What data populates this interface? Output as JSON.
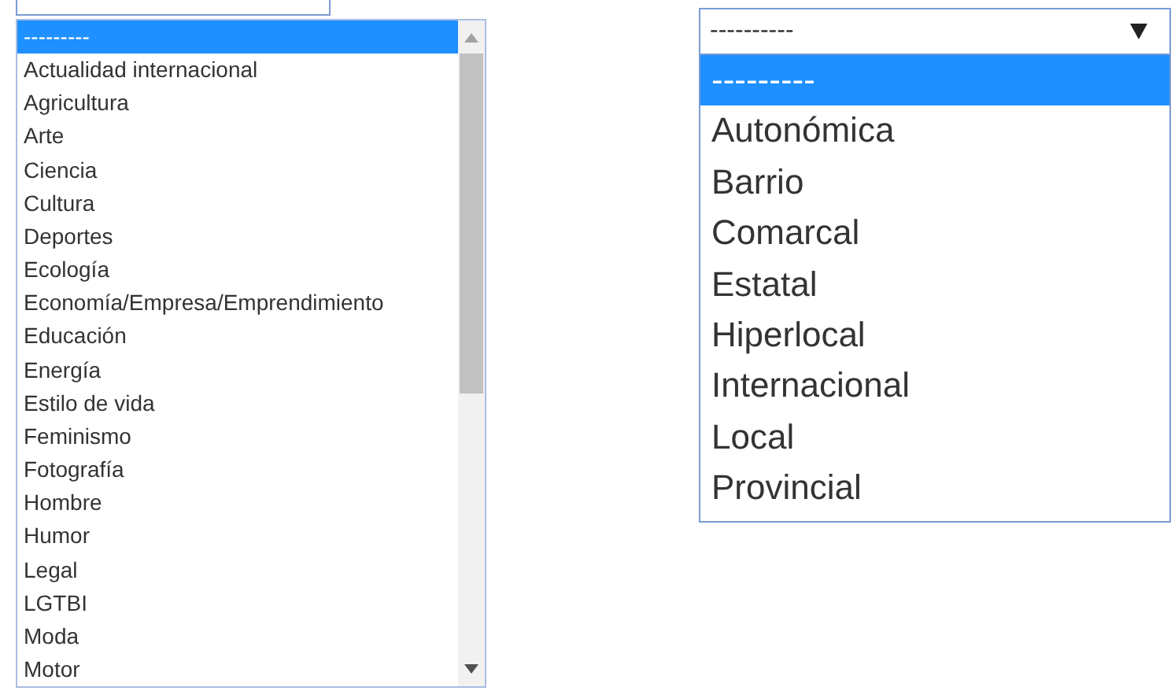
{
  "category_list": {
    "options": [
      {
        "label": "---------",
        "selected": true
      },
      {
        "label": "Actualidad internacional",
        "selected": false
      },
      {
        "label": "Agricultura",
        "selected": false
      },
      {
        "label": "Arte",
        "selected": false
      },
      {
        "label": "Ciencia",
        "selected": false
      },
      {
        "label": "Cultura",
        "selected": false
      },
      {
        "label": "Deportes",
        "selected": false
      },
      {
        "label": "Ecología",
        "selected": false
      },
      {
        "label": "Economía/Empresa/Emprendimiento",
        "selected": false
      },
      {
        "label": "Educación",
        "selected": false
      },
      {
        "label": "Energía",
        "selected": false
      },
      {
        "label": "Estilo de vida",
        "selected": false
      },
      {
        "label": "Feminismo",
        "selected": false
      },
      {
        "label": "Fotografía",
        "selected": false
      },
      {
        "label": "Hombre",
        "selected": false
      },
      {
        "label": "Humor",
        "selected": false
      },
      {
        "label": "Legal",
        "selected": false
      },
      {
        "label": "LGTBI",
        "selected": false
      },
      {
        "label": "Moda",
        "selected": false
      },
      {
        "label": "Motor",
        "selected": false
      }
    ]
  },
  "scope_select": {
    "value": "----------",
    "expanded": true,
    "options": [
      {
        "label": "---------",
        "selected": true
      },
      {
        "label": "Autonómica",
        "selected": false
      },
      {
        "label": "Barrio",
        "selected": false
      },
      {
        "label": "Comarcal",
        "selected": false
      },
      {
        "label": "Estatal",
        "selected": false
      },
      {
        "label": "Hiperlocal",
        "selected": false
      },
      {
        "label": "Internacional",
        "selected": false
      },
      {
        "label": "Local",
        "selected": false
      },
      {
        "label": "Provincial",
        "selected": false
      }
    ]
  }
}
